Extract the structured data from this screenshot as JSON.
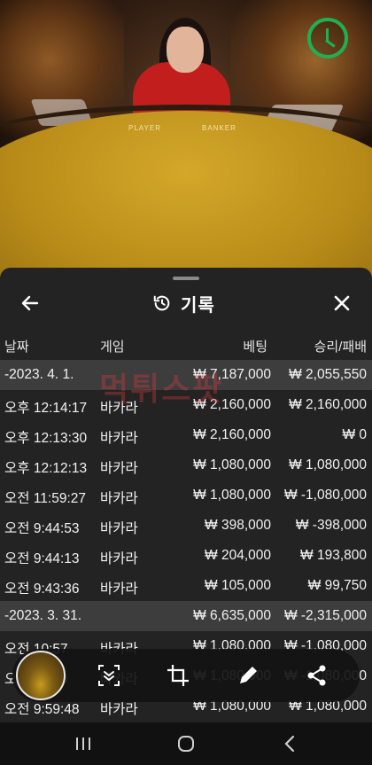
{
  "panel": {
    "title": "기록",
    "columns": {
      "date": "날짜",
      "game": "게임",
      "bet": "베팅",
      "result": "승리/패배"
    }
  },
  "video": {
    "table_player": "PLAYER",
    "table_banker": "BANKER"
  },
  "rows": [
    {
      "type": "day",
      "time": "-2023. 4. 1.",
      "game": "",
      "bet": "₩ 7,187,000",
      "result": "₩ 2,055,550"
    },
    {
      "type": "entry",
      "time": "오후 12:14:17",
      "game": "바카라",
      "bet": "₩ 2,160,000",
      "result": "₩ 2,160,000"
    },
    {
      "type": "entry",
      "time": "오후 12:13:30",
      "game": "바카라",
      "bet": "₩ 2,160,000",
      "result": "₩ 0"
    },
    {
      "type": "entry",
      "time": "오후 12:12:13",
      "game": "바카라",
      "bet": "₩ 1,080,000",
      "result": "₩ 1,080,000"
    },
    {
      "type": "entry",
      "time": "오전 11:59:27",
      "game": "바카라",
      "bet": "₩ 1,080,000",
      "result": "₩ -1,080,000"
    },
    {
      "type": "entry",
      "time": "오전 9:44:53",
      "game": "바카라",
      "bet": "₩ 398,000",
      "result": "₩ -398,000"
    },
    {
      "type": "entry",
      "time": "오전 9:44:13",
      "game": "바카라",
      "bet": "₩ 204,000",
      "result": "₩ 193,800"
    },
    {
      "type": "entry",
      "time": "오전 9:43:36",
      "game": "바카라",
      "bet": "₩ 105,000",
      "result": "₩ 99,750"
    },
    {
      "type": "day",
      "time": "-2023. 3. 31.",
      "game": "",
      "bet": "₩ 6,635,000",
      "result": "₩ -2,315,000"
    },
    {
      "type": "entry",
      "time": "오전 10:57",
      "game": "바카라",
      "bet": "₩ 1,080,000",
      "result": "₩ -1,080,000"
    },
    {
      "type": "entry",
      "time": "오전 10:20",
      "game": "바카라",
      "bet": "₩ 1,080,000",
      "result": "₩ -1,080,000"
    },
    {
      "type": "entry",
      "time": "오전 9:59:48",
      "game": "바카라",
      "bet": "₩ 1,080,000",
      "result": "₩ 1,080,000"
    }
  ],
  "watermark": "먹튀스팟",
  "icons": {
    "back": "arrow-left-icon",
    "history": "history-icon",
    "close": "close-icon",
    "timer": "clock-icon",
    "toolbar": [
      "scroll-capture-icon",
      "crop-icon",
      "edit-icon",
      "share-icon"
    ],
    "nav": [
      "recents-icon",
      "home-icon",
      "back-nav-icon"
    ]
  },
  "colors": {
    "timer": "#1fb052",
    "felt": "#c99a1e",
    "panel": "#232323",
    "day_row": "#3d3d3d"
  }
}
